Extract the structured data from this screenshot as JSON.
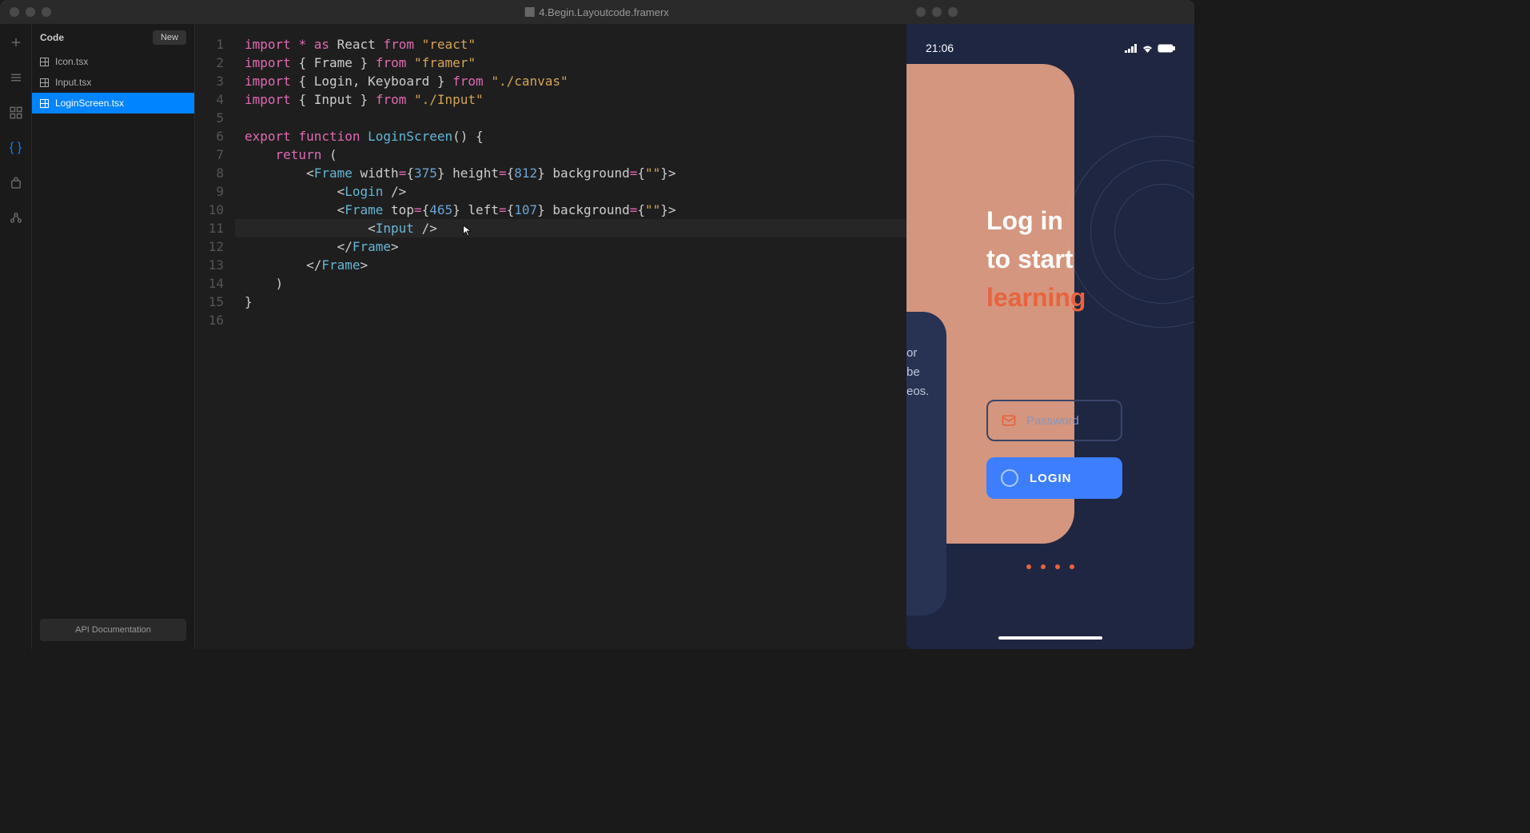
{
  "titlebar": {
    "title": "4.Begin.Layoutcode.framerx"
  },
  "sidebar": {
    "title": "Code",
    "new_button": "New",
    "files": [
      {
        "name": "Icon.tsx"
      },
      {
        "name": "Input.tsx"
      },
      {
        "name": "LoginScreen.tsx"
      }
    ],
    "api_docs": "API Documentation"
  },
  "editor": {
    "line_count": 16,
    "code": {
      "l1_import": "import",
      "l1_star": "*",
      "l1_as": "as",
      "l1_react": "React",
      "l1_from": "from",
      "l1_str": "\"react\"",
      "l2_import": "import",
      "l2_frame": "Frame",
      "l2_from": "from",
      "l2_str": "\"framer\"",
      "l3_import": "import",
      "l3_login": "Login",
      "l3_comma": ",",
      "l3_keyboard": "Keyboard",
      "l3_from": "from",
      "l3_str": "\"./canvas\"",
      "l4_import": "import",
      "l4_input": "Input",
      "l4_from": "from",
      "l4_str": "\"./Input\"",
      "l6_export": "export",
      "l6_function": "function",
      "l6_name": "LoginScreen",
      "l7_return": "return",
      "l8_frame": "Frame",
      "l8_width": "width",
      "l8_wval": "375",
      "l8_height": "height",
      "l8_hval": "812",
      "l8_bg": "background",
      "l8_bgval": "\"\"",
      "l9_login": "Login",
      "l10_frame": "Frame",
      "l10_top": "top",
      "l10_tval": "465",
      "l10_left": "left",
      "l10_lval": "107",
      "l10_bg": "background",
      "l10_bgval": "\"\"",
      "l11_input": "Input",
      "l12_frame": "Frame",
      "l13_frame": "Frame"
    }
  },
  "preview": {
    "status_time": "21:06",
    "heading_line1": "Log in",
    "heading_line2": "to start",
    "heading_line3": "learning",
    "body_line1": "or",
    "body_line2": "be",
    "body_line3": "eos.",
    "password_placeholder": "Password",
    "login_button": "LOGIN"
  }
}
